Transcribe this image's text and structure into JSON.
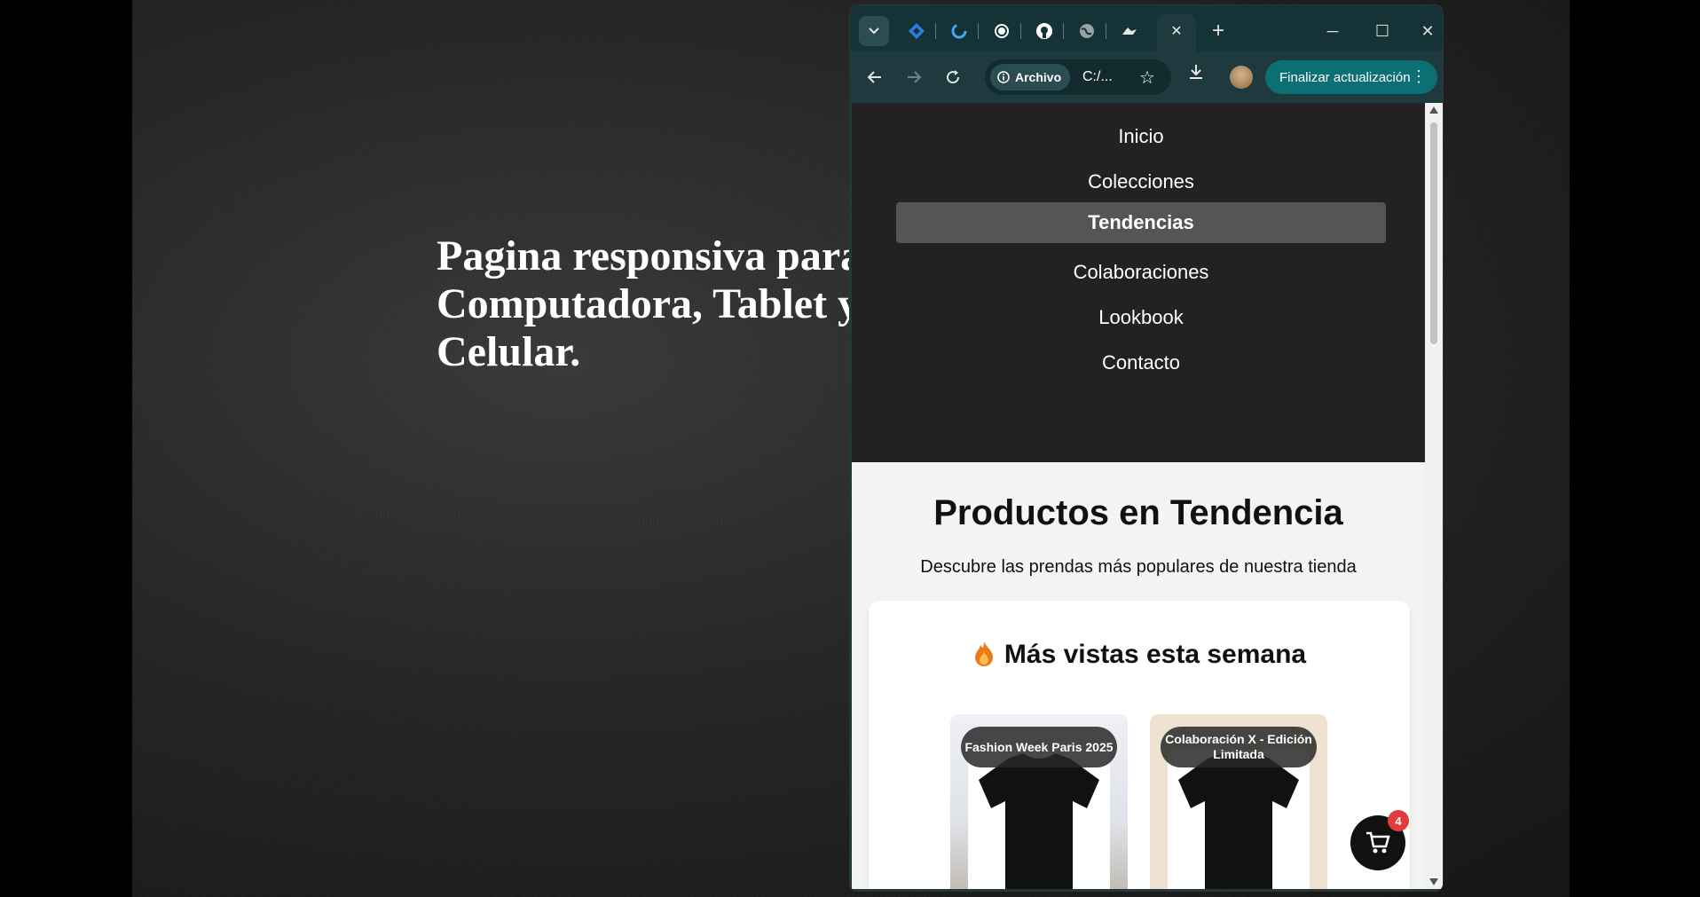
{
  "background": {
    "headline": "Pagina responsiva para Computadora, Tablet y Celular."
  },
  "browser": {
    "tabs": [
      {
        "icon": "chevron-down-icon"
      },
      {
        "icon": "jira-icon"
      },
      {
        "icon": "loading-icon"
      },
      {
        "icon": "openai-icon"
      },
      {
        "icon": "github-icon"
      },
      {
        "icon": "globe-icon"
      },
      {
        "icon": "active-tab-icon"
      }
    ],
    "close_tab_glyph": "✕",
    "new_tab_glyph": "+",
    "minimize_glyph": "─",
    "maximize_glyph": "☐",
    "close_window_glyph": "✕",
    "chip_label": "Archivo",
    "url": "C:/...",
    "update_label": "Finalizar actualización",
    "colors": {
      "frame": "#153236",
      "toolbar": "#1f3a3f",
      "update": "#0b6f74"
    }
  },
  "page": {
    "menu": [
      {
        "label": "Inicio",
        "active": false
      },
      {
        "label": "Colecciones",
        "active": false
      },
      {
        "label": "Tendencias",
        "active": true
      },
      {
        "label": "Colaboraciones",
        "active": false
      },
      {
        "label": "Lookbook",
        "active": false
      },
      {
        "label": "Contacto",
        "active": false
      }
    ],
    "section_title": "Productos en Tendencia",
    "section_subtitle": "Descubre las prendas más populares de nuestra tienda",
    "card_title": "Más vistas esta semana",
    "products": [
      {
        "tag": "Fashion Week Paris 2025"
      },
      {
        "tag": "Colaboración X - Edición Limitada"
      }
    ],
    "cart_count": "4"
  }
}
